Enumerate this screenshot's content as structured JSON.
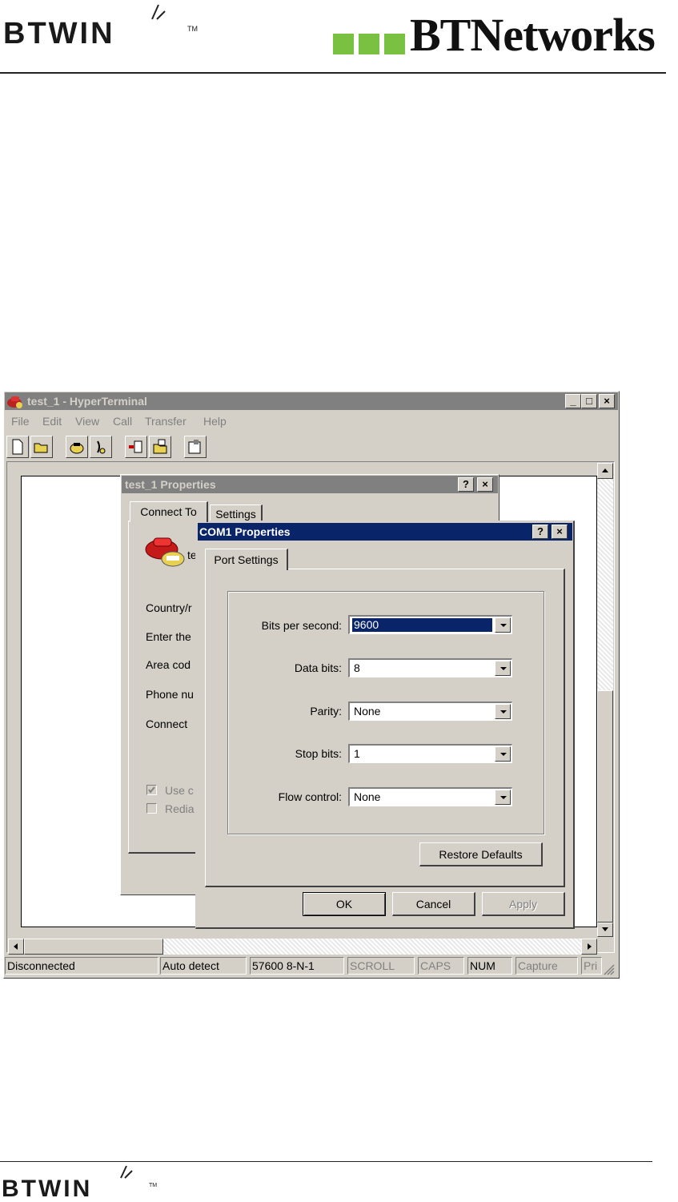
{
  "header": {
    "left_logo": "BTWIN",
    "left_tm": "TM",
    "right_logo": "BTNetworks"
  },
  "footer": {
    "logo": "BTWIN",
    "tm": "TM"
  },
  "main_window": {
    "title": "test_1 - HyperTerminal",
    "menu": [
      "File",
      "Edit",
      "View",
      "Call",
      "Transfer",
      "Help"
    ],
    "caption_buttons": {
      "minimize": "_",
      "maximize": "□",
      "close": "×"
    },
    "status_bar": [
      "Disconnected",
      "Auto detect",
      "57600 8-N-1",
      "SCROLL",
      "CAPS",
      "NUM",
      "Capture",
      "Pri"
    ]
  },
  "properties_dialog": {
    "title": "test_1 Properties",
    "caption_help": "?",
    "caption_close": "×",
    "tabs": [
      "Connect To",
      "Settings"
    ],
    "connection_name": "te",
    "labels": [
      "Country/r",
      "Enter the",
      "Area cod",
      "Phone nu",
      "Connect"
    ],
    "checkboxes": [
      "Use c",
      "Redia"
    ]
  },
  "com_dialog": {
    "title": "COM1 Properties",
    "caption_help": "?",
    "caption_close": "×",
    "tab": "Port Settings",
    "fields": [
      {
        "label": "Bits per second:",
        "value": "9600"
      },
      {
        "label": "Data bits:",
        "value": "8"
      },
      {
        "label": "Parity:",
        "value": "None"
      },
      {
        "label": "Stop bits:",
        "value": "1"
      },
      {
        "label": "Flow control:",
        "value": "None"
      }
    ],
    "restore_defaults": "Restore Defaults",
    "ok": "OK",
    "cancel": "Cancel",
    "apply": "Apply"
  }
}
